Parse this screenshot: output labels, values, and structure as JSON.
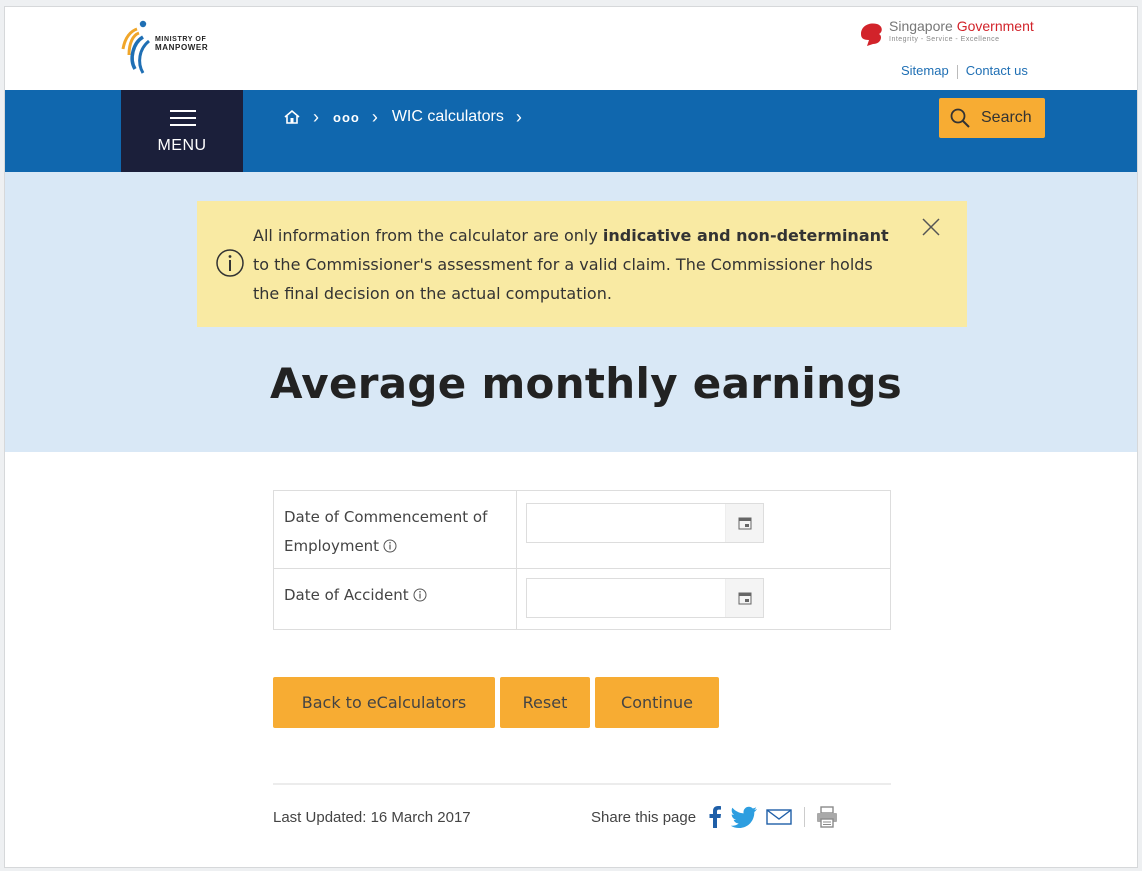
{
  "header": {
    "ministry_line1": "MINISTRY OF",
    "ministry_line2": "MANPOWER",
    "gov_name_part1": "Singapore ",
    "gov_name_part2": "Government",
    "gov_tagline": "Integrity - Service - Excellence",
    "sitemap": "Sitemap",
    "contact": "Contact us"
  },
  "nav": {
    "menu_label": "MENU",
    "breadcrumb_current": "WIC calculators",
    "search_label": "Search"
  },
  "notice": {
    "text_a": "All information from the calculator are only ",
    "text_b": "indicative and non-determinant",
    "text_c": " to the Commissioner's assessment for a valid claim. The Commissioner holds the final decision on the actual computation."
  },
  "page": {
    "title": "Average monthly earnings"
  },
  "form": {
    "rows": [
      {
        "label": "Date of Commencement of Employment",
        "value": "",
        "placeholder": ""
      },
      {
        "label": "Date of Accident",
        "value": "",
        "placeholder": ""
      }
    ]
  },
  "actions": {
    "back": "Back to eCalculators",
    "reset": "Reset",
    "continue": "Continue"
  },
  "footer": {
    "last_updated": "Last Updated: 16 March 2017",
    "share_label": "Share this page"
  },
  "colors": {
    "nav_blue": "#1067ae",
    "menu_dark": "#1b1f3a",
    "accent_orange": "#f7ac33",
    "notice_yellow": "#f9eaa3",
    "hero_blue": "#d9e8f6"
  },
  "icons": [
    "mom-logo",
    "sg-lion-icon",
    "home-icon",
    "search-icon",
    "info-icon",
    "close-icon",
    "calendar-icon",
    "facebook-icon",
    "twitter-icon",
    "email-icon",
    "print-icon"
  ]
}
